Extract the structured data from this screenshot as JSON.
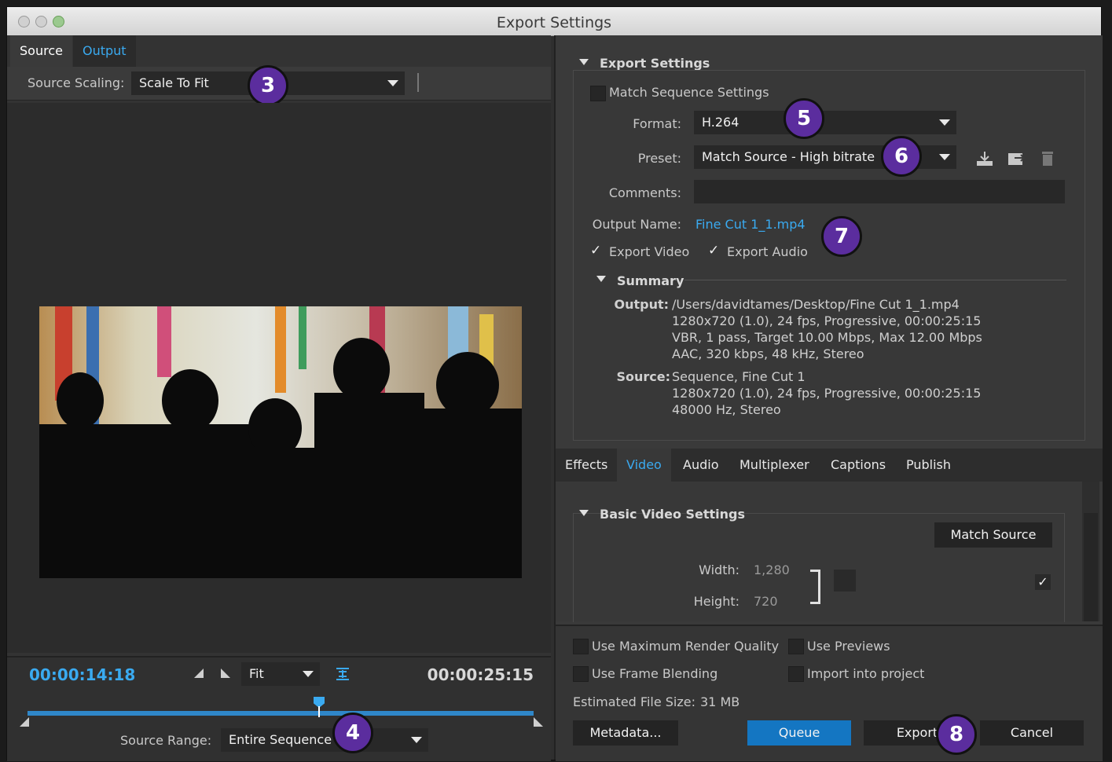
{
  "window": {
    "title": "Export Settings"
  },
  "left": {
    "tabs": [
      {
        "label": "Source"
      },
      {
        "label": "Output"
      }
    ],
    "source_scaling": {
      "label": "Source Scaling:",
      "value": "Scale To Fit"
    },
    "timeline": {
      "current_time": "00:00:14:18",
      "total_time": "00:00:25:15",
      "zoom": "Fit",
      "playhead_position": 0.58,
      "source_range": {
        "label": "Source Range:",
        "value": "Entire Sequence"
      }
    }
  },
  "export_settings": {
    "header": "Export Settings",
    "match_sequence": {
      "label": "Match Sequence Settings",
      "checked": false
    },
    "format": {
      "label": "Format:",
      "value": "H.264"
    },
    "preset": {
      "label": "Preset:",
      "value": "Match Source - High bitrate"
    },
    "comments": {
      "label": "Comments:",
      "value": ""
    },
    "output_name": {
      "label": "Output Name:",
      "value": "Fine Cut 1_1.mp4"
    },
    "export_video": {
      "label": "Export Video",
      "checked": true
    },
    "export_audio": {
      "label": "Export Audio",
      "checked": true
    },
    "summary": {
      "header": "Summary",
      "output_label": "Output:",
      "output_lines": [
        "/Users/davidtames/Desktop/Fine Cut 1_1.mp4",
        "1280x720 (1.0), 24 fps, Progressive, 00:00:25:15",
        "VBR, 1 pass, Target 10.00 Mbps, Max 12.00 Mbps",
        "AAC, 320 kbps, 48 kHz, Stereo"
      ],
      "source_label": "Source:",
      "source_lines": [
        "Sequence, Fine Cut 1",
        "1280x720 (1.0), 24 fps, Progressive, 00:00:25:15",
        "48000 Hz, Stereo"
      ]
    }
  },
  "subtabs": [
    {
      "label": "Effects"
    },
    {
      "label": "Video"
    },
    {
      "label": "Audio"
    },
    {
      "label": "Multiplexer"
    },
    {
      "label": "Captions"
    },
    {
      "label": "Publish"
    }
  ],
  "basic_video": {
    "header": "Basic Video Settings",
    "match_source_label": "Match Source",
    "width": {
      "label": "Width:",
      "value": "1,280"
    },
    "height": {
      "label": "Height:",
      "value": "720"
    }
  },
  "bottom": {
    "max_render": "Use Maximum Render Quality",
    "use_previews": "Use Previews",
    "frame_blending": "Use Frame Blending",
    "import_project": "Import into project",
    "file_size_label": "Estimated File Size:",
    "file_size_value": "31 MB",
    "metadata_label": "Metadata...",
    "queue_label": "Queue",
    "export_label": "Export",
    "cancel_label": "Cancel"
  },
  "annotations": [
    "3",
    "4",
    "5",
    "6",
    "7",
    "8"
  ],
  "colors": {
    "accent": "#3aaaf0",
    "badge": "#5b2d9e",
    "queue": "#1476c2"
  }
}
